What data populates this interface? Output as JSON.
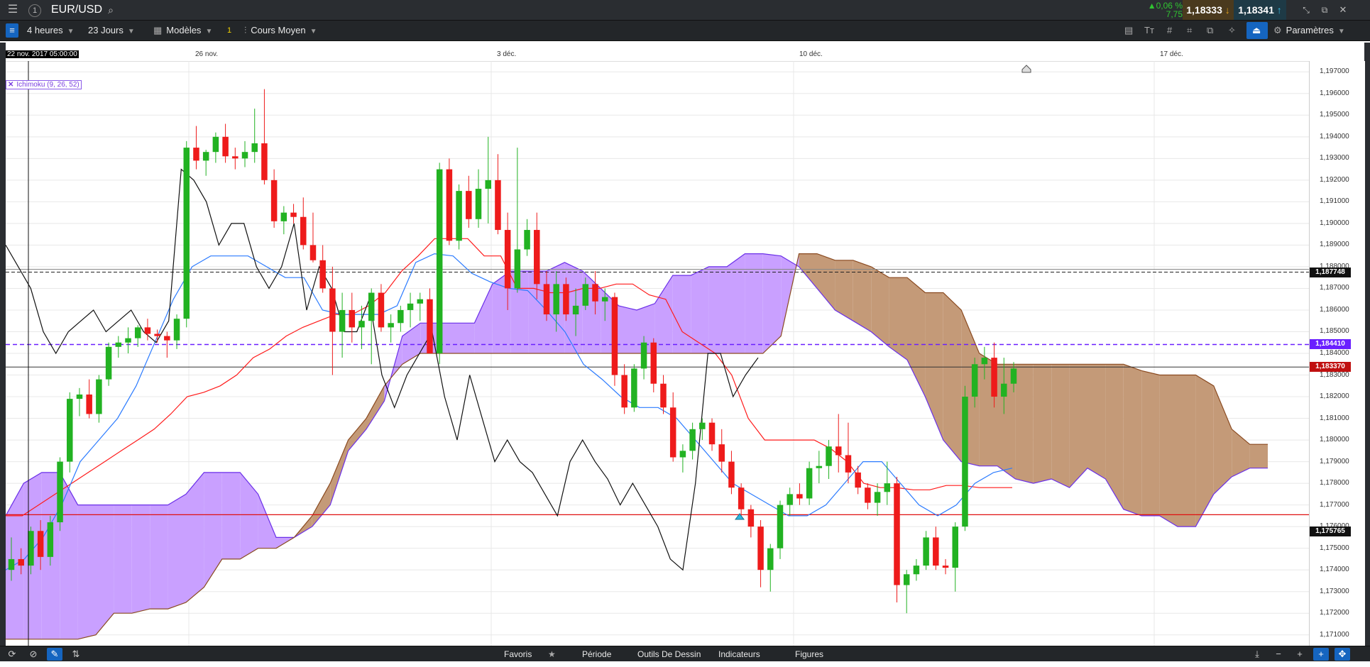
{
  "topbar": {
    "menu_icon": "hamburger-icon",
    "info_label": "1",
    "symbol": "EUR/USD",
    "change_pct": "▲0,06 %",
    "change_pts": "7,75",
    "bid": "1,18333",
    "ask": "1,18341"
  },
  "toolbar": {
    "interval": "4 heures",
    "range": "23 Jours",
    "templates": "Modèles",
    "template_badge": "1",
    "price_type": "Cours Moyen",
    "settings": "Paramètres"
  },
  "indicator_label": "Ichimoku (9, 26, 52)",
  "bottombar": {
    "favorites": "Favoris",
    "period": "Période",
    "drawing_tools": "Outils De Dessin",
    "indicators": "Indicateurs",
    "figures": "Figures"
  },
  "colors": {
    "up": "#22b222",
    "down": "#ee1b1b",
    "tenkan": "#ff1a1a",
    "kijun": "#2b7bff",
    "chikou": "#111111",
    "kumo_bull": "#c9a0ff",
    "kumo_bear": "#c49a78",
    "span_a": "#6a2fe8",
    "span_b": "#8a4a20"
  },
  "chart_data": {
    "type": "candlestick",
    "title": "EUR/USD",
    "interval": "4 heures",
    "x_labels": [
      "22 nov. 2017 05:00:00",
      "26 nov.",
      "3 déc.",
      "10 déc.",
      "17 déc."
    ],
    "y_ticks": [
      "1,197000",
      "1,196000",
      "1,195000",
      "1,194000",
      "1,193000",
      "1,192000",
      "1,191000",
      "1,190000",
      "1,189000",
      "1,188000",
      "1,187000",
      "1,186000",
      "1,185000",
      "1,184000",
      "1,183000",
      "1,182000",
      "1,181000",
      "1,180000",
      "1,179000",
      "1,178000",
      "1,177000",
      "1,176000",
      "1,175000",
      "1,174000",
      "1,173000",
      "1,172000",
      "1,171000"
    ],
    "ylim": [
      1.1705,
      1.1975
    ],
    "price_tags": {
      "top_level": "1,187748",
      "purple_level": "1,184410",
      "current": "1,183370",
      "low_level": "1,175765"
    },
    "levels": {
      "black_dashed": 1.18775,
      "purple_dashed": 1.18441,
      "current": 1.18337,
      "red": 1.17655
    },
    "candles": [
      [
        1.174,
        1.1755,
        1.1735,
        1.1745
      ],
      [
        1.1745,
        1.175,
        1.1738,
        1.1742
      ],
      [
        1.1742,
        1.176,
        1.1738,
        1.1758
      ],
      [
        1.1758,
        1.1763,
        1.174,
        1.1746
      ],
      [
        1.1746,
        1.1765,
        1.1742,
        1.1762
      ],
      [
        1.1762,
        1.1792,
        1.1758,
        1.179
      ],
      [
        1.179,
        1.1822,
        1.1785,
        1.1819
      ],
      [
        1.1819,
        1.1824,
        1.1811,
        1.1821
      ],
      [
        1.1821,
        1.1828,
        1.181,
        1.1812
      ],
      [
        1.1812,
        1.183,
        1.1808,
        1.1828
      ],
      [
        1.1828,
        1.1845,
        1.1825,
        1.1843
      ],
      [
        1.1843,
        1.1848,
        1.1838,
        1.1845
      ],
      [
        1.1845,
        1.1852,
        1.184,
        1.1847
      ],
      [
        1.1847,
        1.1853,
        1.1843,
        1.1852
      ],
      [
        1.1852,
        1.1856,
        1.1846,
        1.1849
      ],
      [
        1.1849,
        1.1851,
        1.1845,
        1.1848
      ],
      [
        1.1848,
        1.185,
        1.1838,
        1.1846
      ],
      [
        1.1846,
        1.1858,
        1.1842,
        1.1856
      ],
      [
        1.1856,
        1.1938,
        1.1852,
        1.1935
      ],
      [
        1.1935,
        1.1945,
        1.1925,
        1.1929
      ],
      [
        1.1929,
        1.1934,
        1.1922,
        1.1933
      ],
      [
        1.1933,
        1.1942,
        1.1928,
        1.194
      ],
      [
        1.194,
        1.1946,
        1.1928,
        1.1931
      ],
      [
        1.1931,
        1.1935,
        1.1925,
        1.193
      ],
      [
        1.193,
        1.1938,
        1.1926,
        1.1933
      ],
      [
        1.1933,
        1.1953,
        1.1928,
        1.1937
      ],
      [
        1.1937,
        1.1962,
        1.1918,
        1.192
      ],
      [
        1.192,
        1.1925,
        1.1898,
        1.1901
      ],
      [
        1.1901,
        1.1908,
        1.1895,
        1.1905
      ],
      [
        1.1905,
        1.1909,
        1.19,
        1.1903
      ],
      [
        1.1903,
        1.1912,
        1.1888,
        1.189
      ],
      [
        1.189,
        1.1905,
        1.1882,
        1.1883
      ],
      [
        1.1883,
        1.189,
        1.1868,
        1.187
      ],
      [
        1.187,
        1.188,
        1.183,
        1.185
      ],
      [
        1.185,
        1.1868,
        1.1838,
        1.186
      ],
      [
        1.186,
        1.1868,
        1.1845,
        1.1852
      ],
      [
        1.1852,
        1.1862,
        1.1842,
        1.1855
      ],
      [
        1.1855,
        1.187,
        1.1835,
        1.1868
      ],
      [
        1.1868,
        1.1872,
        1.185,
        1.1852
      ],
      [
        1.1852,
        1.1858,
        1.1845,
        1.1854
      ],
      [
        1.1854,
        1.1862,
        1.185,
        1.186
      ],
      [
        1.186,
        1.1868,
        1.1852,
        1.1863
      ],
      [
        1.1863,
        1.1868,
        1.1855,
        1.1865
      ],
      [
        1.1865,
        1.187,
        1.185,
        1.184
      ],
      [
        1.184,
        1.1928,
        1.1835,
        1.1925
      ],
      [
        1.1925,
        1.193,
        1.189,
        1.1892
      ],
      [
        1.1892,
        1.1918,
        1.1888,
        1.1915
      ],
      [
        1.1915,
        1.1922,
        1.1898,
        1.1902
      ],
      [
        1.1902,
        1.1925,
        1.1898,
        1.1916
      ],
      [
        1.1916,
        1.194,
        1.19,
        1.192
      ],
      [
        1.192,
        1.1932,
        1.1895,
        1.1897
      ],
      [
        1.1897,
        1.1905,
        1.186,
        1.187
      ],
      [
        1.187,
        1.1935,
        1.1868,
        1.1888
      ],
      [
        1.1888,
        1.1902,
        1.1885,
        1.1897
      ],
      [
        1.1897,
        1.1905,
        1.1865,
        1.1872
      ],
      [
        1.1872,
        1.1878,
        1.1855,
        1.1858
      ],
      [
        1.1858,
        1.1878,
        1.185,
        1.1872
      ],
      [
        1.1872,
        1.1875,
        1.1855,
        1.1858
      ],
      [
        1.1858,
        1.187,
        1.1848,
        1.1862
      ],
      [
        1.1862,
        1.1875,
        1.186,
        1.1872
      ],
      [
        1.1872,
        1.1878,
        1.1858,
        1.1864
      ],
      [
        1.1864,
        1.187,
        1.1855,
        1.1866
      ],
      [
        1.1866,
        1.1868,
        1.1825,
        1.183
      ],
      [
        1.183,
        1.1835,
        1.1812,
        1.1815
      ],
      [
        1.1815,
        1.1835,
        1.1813,
        1.1833
      ],
      [
        1.1833,
        1.1848,
        1.1828,
        1.1845
      ],
      [
        1.1845,
        1.1847,
        1.1822,
        1.1826
      ],
      [
        1.1826,
        1.183,
        1.1812,
        1.1815
      ],
      [
        1.1815,
        1.1822,
        1.179,
        1.1792
      ],
      [
        1.1792,
        1.1798,
        1.1785,
        1.1795
      ],
      [
        1.1795,
        1.1808,
        1.1791,
        1.1805
      ],
      [
        1.1805,
        1.181,
        1.18,
        1.1808
      ],
      [
        1.1808,
        1.181,
        1.1795,
        1.1798
      ],
      [
        1.1798,
        1.1805,
        1.1785,
        1.179
      ],
      [
        1.179,
        1.1795,
        1.1775,
        1.1778
      ],
      [
        1.1778,
        1.178,
        1.1765,
        1.1768
      ],
      [
        1.1768,
        1.177,
        1.1755,
        1.176
      ],
      [
        1.176,
        1.1763,
        1.1732,
        1.174
      ],
      [
        1.174,
        1.1752,
        1.173,
        1.175
      ],
      [
        1.175,
        1.1772,
        1.1745,
        1.177
      ],
      [
        1.177,
        1.1778,
        1.1765,
        1.1775
      ],
      [
        1.1775,
        1.178,
        1.177,
        1.1773
      ],
      [
        1.1773,
        1.179,
        1.177,
        1.1787
      ],
      [
        1.1787,
        1.1795,
        1.178,
        1.1788
      ],
      [
        1.1788,
        1.18,
        1.1782,
        1.1797
      ],
      [
        1.1797,
        1.1812,
        1.1785,
        1.1793
      ],
      [
        1.1793,
        1.1808,
        1.178,
        1.1785
      ],
      [
        1.1785,
        1.1788,
        1.1775,
        1.1778
      ],
      [
        1.1778,
        1.178,
        1.1768,
        1.1771
      ],
      [
        1.1771,
        1.178,
        1.1765,
        1.1776
      ],
      [
        1.1776,
        1.179,
        1.177,
        1.178
      ],
      [
        1.178,
        1.1783,
        1.1725,
        1.1733
      ],
      [
        1.1733,
        1.174,
        1.172,
        1.1738
      ],
      [
        1.1738,
        1.1745,
        1.1735,
        1.1742
      ],
      [
        1.1742,
        1.1758,
        1.174,
        1.1755
      ],
      [
        1.1755,
        1.176,
        1.174,
        1.1742
      ],
      [
        1.1742,
        1.1745,
        1.1738,
        1.1741
      ],
      [
        1.1741,
        1.1762,
        1.173,
        1.176
      ],
      [
        1.176,
        1.1825,
        1.1758,
        1.182
      ],
      [
        1.182,
        1.1838,
        1.1815,
        1.1835
      ],
      [
        1.1835,
        1.1843,
        1.1828,
        1.1838
      ],
      [
        1.1838,
        1.1845,
        1.1815,
        1.182
      ],
      [
        1.182,
        1.1838,
        1.1812,
        1.1826
      ],
      [
        1.1826,
        1.1836,
        1.1822,
        1.1833
      ]
    ],
    "series": [
      {
        "name": "tenkan",
        "values": [
          1.1765,
          1.1765,
          1.177,
          1.1775,
          1.178,
          1.1785,
          1.179,
          1.1795,
          1.18,
          1.1805,
          1.1812,
          1.182,
          1.1822,
          1.1825,
          1.183,
          1.1838,
          1.1842,
          1.1848,
          1.1852,
          1.1855,
          1.1858,
          1.1858,
          1.1862,
          1.1868,
          1.1878,
          1.1885,
          1.1893,
          1.1893,
          1.1893,
          1.1885,
          1.1885,
          1.187,
          1.187,
          1.1868,
          1.1868,
          1.187,
          1.187,
          1.1872,
          1.1872,
          1.1867,
          1.1865,
          1.185,
          1.1845,
          1.184,
          1.183,
          1.181,
          1.18,
          1.18,
          1.18,
          1.18,
          1.1796,
          1.179,
          1.178,
          1.1778,
          1.1778,
          1.1777,
          1.1777,
          1.1779,
          1.1779,
          1.1778,
          1.1778,
          1.1778
        ]
      },
      {
        "name": "kijun",
        "values": [
          1.174,
          1.1745,
          1.1755,
          1.177,
          1.179,
          1.18,
          1.181,
          1.1825,
          1.1845,
          1.1865,
          1.188,
          1.1885,
          1.1885,
          1.1885,
          1.188,
          1.1875,
          1.1875,
          1.186,
          1.1858,
          1.1858,
          1.1858,
          1.1862,
          1.1882,
          1.1886,
          1.1885,
          1.1877,
          1.1873,
          1.187,
          1.1869,
          1.186,
          1.185,
          1.1835,
          1.1828,
          1.182,
          1.1815,
          1.1815,
          1.181,
          1.18,
          1.179,
          1.178,
          1.1775,
          1.177,
          1.1765,
          1.1765,
          1.177,
          1.178,
          1.179,
          1.179,
          1.178,
          1.177,
          1.1765,
          1.177,
          1.178,
          1.1785,
          1.1787
        ]
      },
      {
        "name": "chikou",
        "values": [
          1.189,
          1.188,
          1.187,
          1.185,
          1.184,
          1.185,
          1.1855,
          1.186,
          1.185,
          1.1855,
          1.186,
          1.185,
          1.1845,
          1.1855,
          1.1925,
          1.192,
          1.191,
          1.189,
          1.19,
          1.19,
          1.188,
          1.187,
          1.188,
          1.19,
          1.186,
          1.188,
          1.187,
          1.185,
          1.185,
          1.1865,
          1.183,
          1.1815,
          1.183,
          1.184,
          1.185,
          1.182,
          1.18,
          1.183,
          1.181,
          1.179,
          1.18,
          1.179,
          1.1785,
          1.1775,
          1.1765,
          1.179,
          1.18,
          1.179,
          1.1782,
          1.177,
          1.178,
          1.177,
          1.176,
          1.1745,
          1.174,
          1.178,
          1.184,
          1.184,
          1.182,
          1.183,
          1.1838
        ]
      }
    ],
    "kumo": {
      "span_a": [
        1.1765,
        1.178,
        1.1785,
        1.1785,
        1.177,
        1.177,
        1.177,
        1.177,
        1.177,
        1.177,
        1.1775,
        1.1785,
        1.1785,
        1.1785,
        1.1775,
        1.1755,
        1.1755,
        1.176,
        1.177,
        1.1795,
        1.1805,
        1.1818,
        1.1848,
        1.1854,
        1.1854,
        1.1854,
        1.1854,
        1.1872,
        1.1878,
        1.1878,
        1.1878,
        1.1882,
        1.1878,
        1.187,
        1.1862,
        1.186,
        1.1863,
        1.1876,
        1.1876,
        1.188,
        1.188,
        1.1886,
        1.1886,
        1.1885,
        1.188,
        1.187,
        1.186,
        1.1855,
        1.185,
        1.1843,
        1.1837,
        1.182,
        1.18,
        1.179,
        1.1788,
        1.1788,
        1.1782,
        1.178,
        1.1782,
        1.1778,
        1.1787,
        1.1782,
        1.1768,
        1.1765,
        1.1765,
        1.176,
        1.176,
        1.1775,
        1.1783,
        1.1787,
        1.1787
      ],
      "span_b": [
        1.1708,
        1.1708,
        1.1708,
        1.1708,
        1.1708,
        1.171,
        1.172,
        1.172,
        1.1722,
        1.1722,
        1.1725,
        1.1732,
        1.1745,
        1.1745,
        1.175,
        1.175,
        1.1755,
        1.1765,
        1.178,
        1.18,
        1.181,
        1.1825,
        1.1835,
        1.184,
        1.184,
        1.184,
        1.184,
        1.184,
        1.184,
        1.184,
        1.184,
        1.184,
        1.184,
        1.184,
        1.184,
        1.184,
        1.184,
        1.184,
        1.184,
        1.184,
        1.184,
        1.184,
        1.184,
        1.1848,
        1.1886,
        1.1886,
        1.1883,
        1.1883,
        1.188,
        1.1875,
        1.1875,
        1.1868,
        1.1868,
        1.186,
        1.184,
        1.1835,
        1.1835,
        1.1835,
        1.1835,
        1.1835,
        1.1835,
        1.1835,
        1.1835,
        1.1832,
        1.183,
        1.183,
        1.183,
        1.1825,
        1.1805,
        1.1798,
        1.1798
      ]
    }
  }
}
